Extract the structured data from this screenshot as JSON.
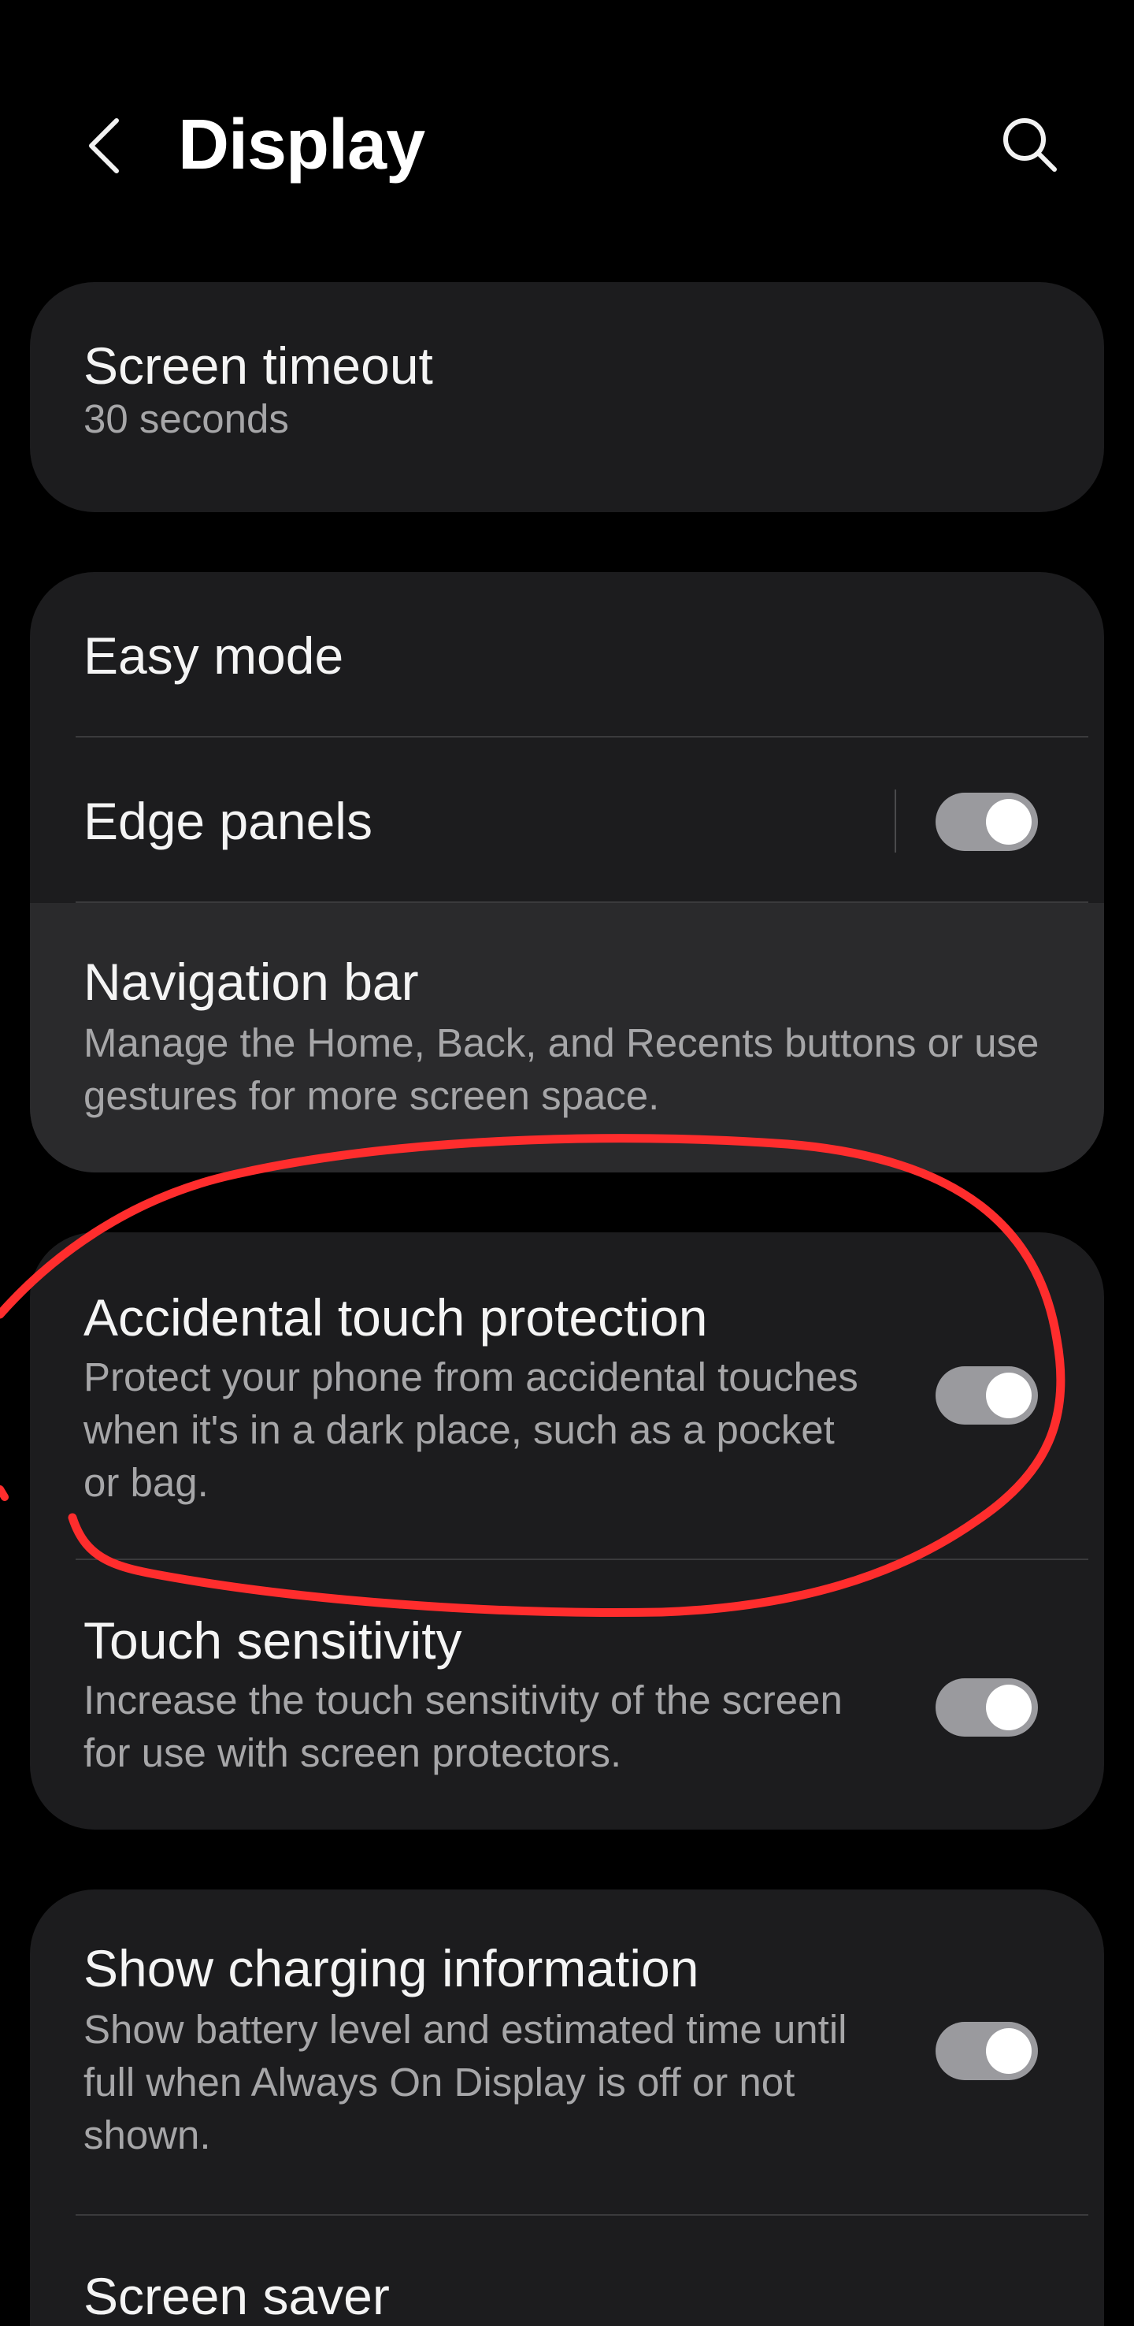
{
  "header": {
    "title": "Display",
    "back_icon": "chevron-left-icon",
    "search_icon": "search-icon"
  },
  "cards": {
    "screen_timeout": {
      "title": "Screen timeout",
      "value": "30 seconds"
    },
    "group2": {
      "easy_mode": {
        "title": "Easy mode"
      },
      "edge_panels": {
        "title": "Edge panels",
        "toggle": "on"
      },
      "navigation_bar": {
        "title": "Navigation bar",
        "subtitle": "Manage the Home, Back, and Recents buttons or use gestures for more screen space."
      }
    },
    "group3": {
      "accidental_touch": {
        "title": "Accidental touch protection",
        "subtitle": "Protect your phone from accidental touches when it's in a dark place, such as a pocket or bag.",
        "toggle": "on"
      },
      "touch_sensitivity": {
        "title": "Touch sensitivity",
        "subtitle": "Increase the touch sensitivity of the screen for use with screen protectors.",
        "toggle": "on"
      }
    },
    "group4": {
      "charging_info": {
        "title": "Show charging information",
        "subtitle": "Show battery level and estimated time until full when Always On Display is off or not shown.",
        "toggle": "on"
      },
      "screen_saver": {
        "title": "Screen saver"
      }
    }
  },
  "colors": {
    "background": "#000000",
    "card": "#1c1c1e",
    "pressed_row": "#2a2a2c",
    "subtitle_text": "#a6a6a8",
    "switch_track": "#9a9a9e",
    "annotation_stroke": "#ff2d2d"
  }
}
